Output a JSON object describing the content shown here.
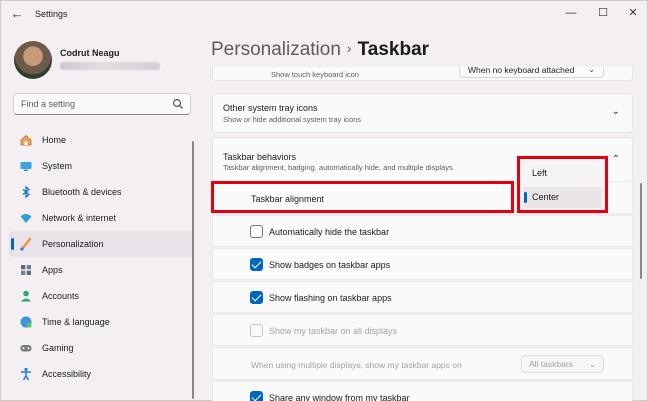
{
  "window": {
    "title": "Settings",
    "controls": {
      "minimize": "—",
      "maximize": "☐",
      "close": "✕"
    }
  },
  "user": {
    "name": "Codrut Neagu"
  },
  "search": {
    "placeholder": "Find a setting"
  },
  "sidebar": {
    "items": [
      {
        "label": "Home",
        "icon": "home-icon",
        "color": "#d08a4a"
      },
      {
        "label": "System",
        "icon": "system-icon",
        "color": "#2b9fd8"
      },
      {
        "label": "Bluetooth & devices",
        "icon": "bluetooth-icon",
        "color": "#1e7bd4"
      },
      {
        "label": "Network & internet",
        "icon": "wifi-icon",
        "color": "#2b9fd8"
      },
      {
        "label": "Personalization",
        "icon": "brush-icon",
        "color": "#d88a3a",
        "active": true
      },
      {
        "label": "Apps",
        "icon": "apps-icon",
        "color": "#5a6b7c"
      },
      {
        "label": "Accounts",
        "icon": "accounts-icon",
        "color": "#2aa876"
      },
      {
        "label": "Time & language",
        "icon": "globe-icon",
        "color": "#2b86d8"
      },
      {
        "label": "Gaming",
        "icon": "gaming-icon",
        "color": "#7a7a7a"
      },
      {
        "label": "Accessibility",
        "icon": "accessibility-icon",
        "color": "#1e7bd4"
      }
    ]
  },
  "breadcrumb": {
    "parent": "Personalization",
    "separator": "›",
    "current": "Taskbar"
  },
  "content": {
    "touch_keyboard": {
      "subtitle": "Show touch keyboard icon",
      "dropdown_value": "When no keyboard attached"
    },
    "system_tray": {
      "title": "Other system tray icons",
      "subtitle": "Show or hide additional system tray icons"
    },
    "taskbar_behaviors": {
      "title": "Taskbar behaviors",
      "subtitle": "Taskbar alignment, badging, automatically hide, and multiple displays"
    },
    "alignment": {
      "label": "Taskbar alignment",
      "options": [
        "Left",
        "Center"
      ],
      "selected": "Center"
    },
    "options": [
      {
        "label": "Automatically hide the taskbar",
        "checked": false,
        "disabled": false
      },
      {
        "label": "Show badges on taskbar apps",
        "checked": true,
        "disabled": false
      },
      {
        "label": "Show flashing on taskbar apps",
        "checked": true,
        "disabled": false
      },
      {
        "label": "Show my taskbar on all displays",
        "checked": false,
        "disabled": true
      }
    ],
    "multi_display": {
      "label": "When using multiple displays, show my taskbar apps on",
      "value": "All taskbars"
    },
    "share_window": {
      "label": "Share any window from my taskbar",
      "checked": true
    }
  },
  "colors": {
    "accent": "#0067c0",
    "highlight": "#e4000f"
  }
}
